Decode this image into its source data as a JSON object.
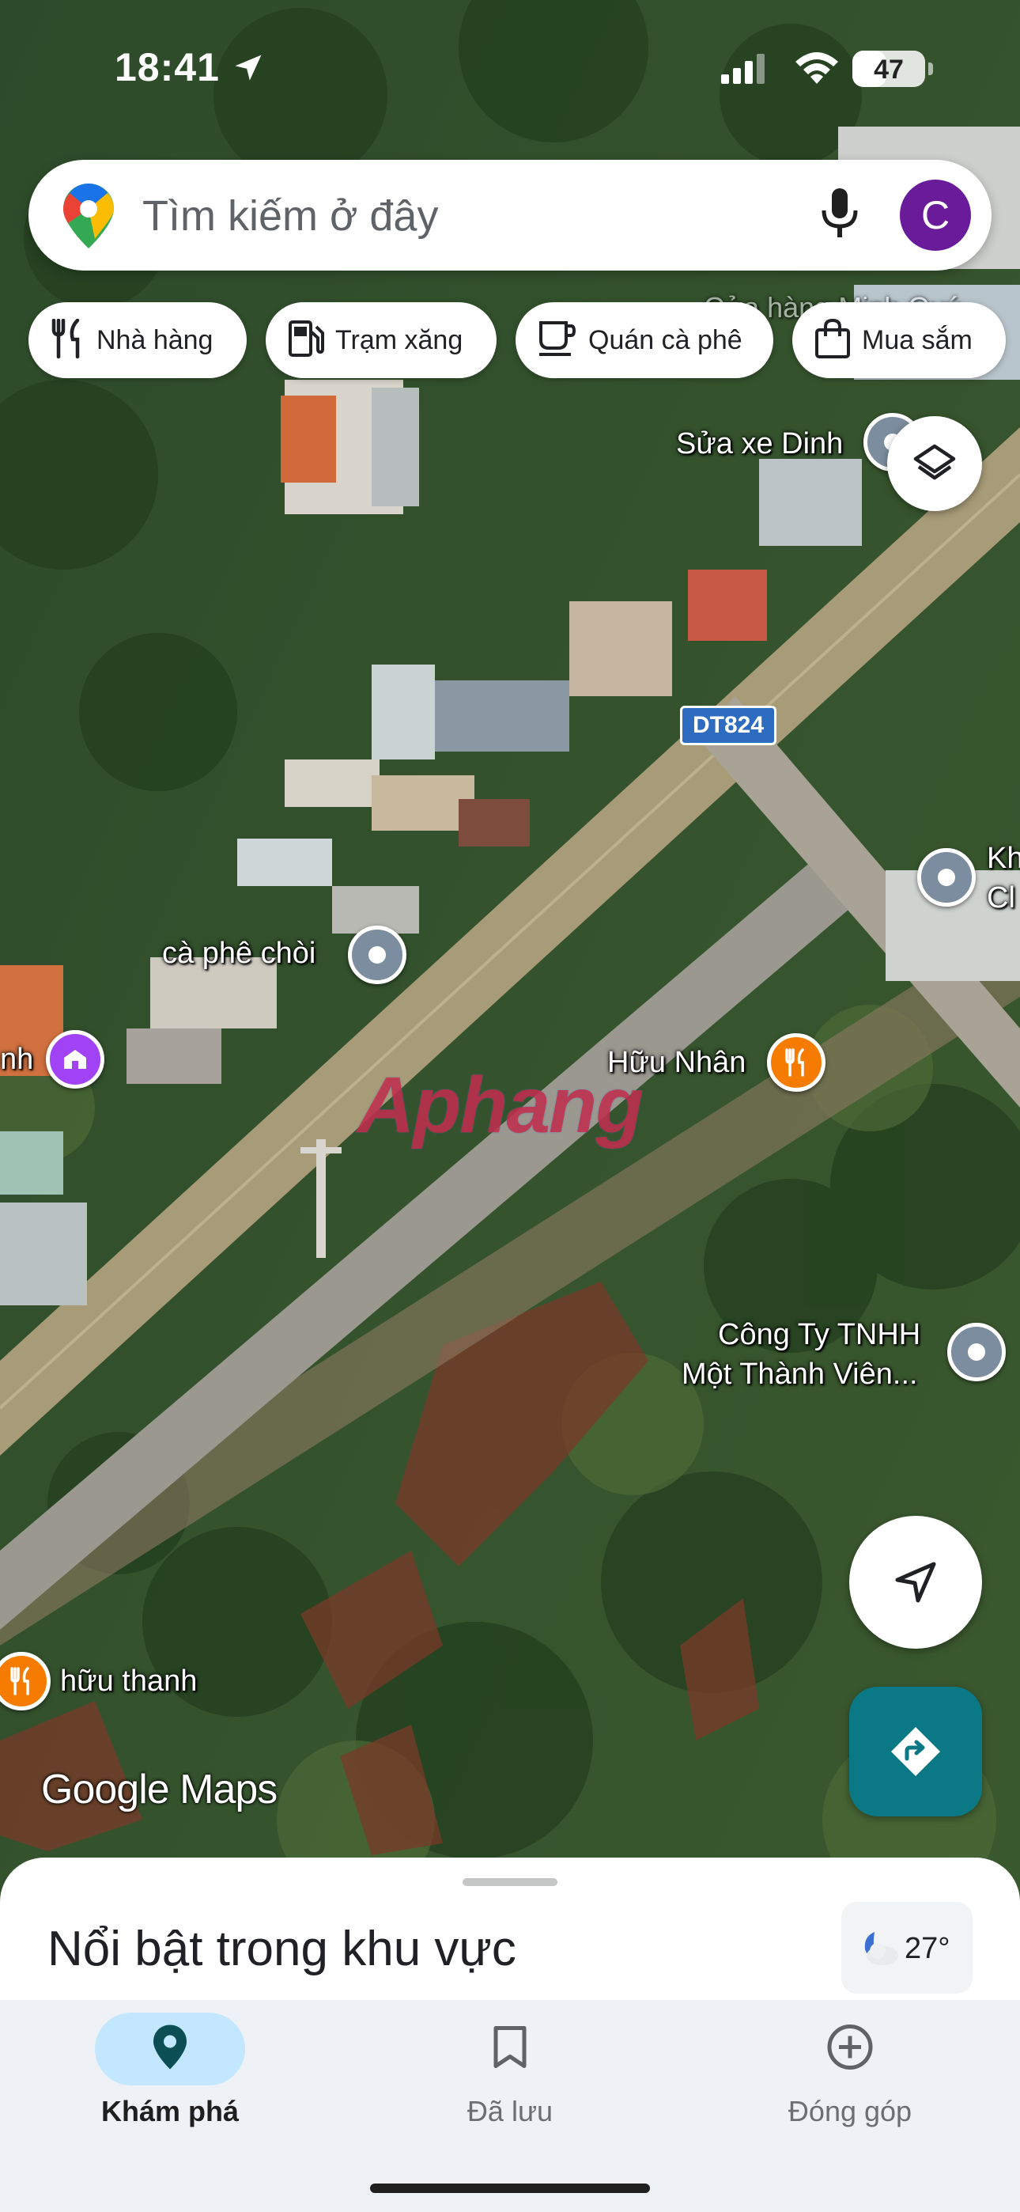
{
  "status_bar": {
    "time": "18:41",
    "battery": "47",
    "battery_fraction": 0.47,
    "icons": [
      "location-arrow-icon",
      "cellular-signal-icon",
      "wifi-icon",
      "battery-icon"
    ]
  },
  "search": {
    "placeholder": "Tìm kiếm ở đây",
    "avatar_initial": "C"
  },
  "chips": [
    {
      "label": "Nhà hàng",
      "icon": "fork-knife-icon"
    },
    {
      "label": "Trạm xăng",
      "icon": "gas-station-icon"
    },
    {
      "label": "Quán cà phê",
      "icon": "coffee-cup-icon"
    },
    {
      "label": "Mua sắm",
      "icon": "shopping-bag-icon"
    }
  ],
  "map": {
    "road_shield": "DT824",
    "places": {
      "sua_xe_dinh": "Sửa xe Dinh",
      "ca_phe_choi": "cà phê chòi",
      "huu_nhan": "Hữu Nhân",
      "cong_ty_line1": "Công Ty TNHH",
      "cong_ty_line2": "Một Thành Viên...",
      "huu_thanh": "hữu thanh",
      "edge_left": "nh",
      "edge_right_1": "Kh",
      "edge_right_2": "Cl",
      "top_partial": "Cửa hàng Minh Quý"
    },
    "watermark": "Aphang",
    "logo": "Google Maps"
  },
  "colors": {
    "accent": "#0b7885",
    "avatar": "#6a1b9a",
    "restaurant_pin": "#f57c00",
    "nav_active_pill": "#c2e7ff"
  },
  "bottom_sheet": {
    "title": "Nổi bật trong khu vực",
    "temperature": "27°"
  },
  "bottom_nav": [
    {
      "label": "Khám phá",
      "icon": "explore-pin-icon",
      "active": true
    },
    {
      "label": "Đã lưu",
      "icon": "bookmark-icon",
      "active": false
    },
    {
      "label": "Đóng góp",
      "icon": "add-circle-icon",
      "active": false
    }
  ]
}
